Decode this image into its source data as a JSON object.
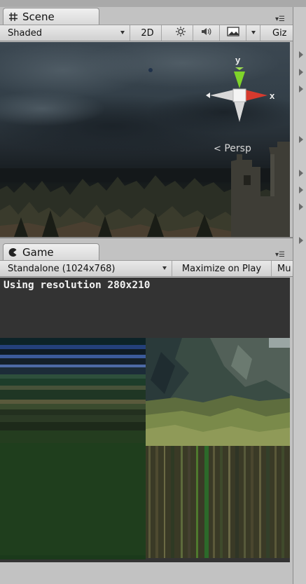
{
  "scene": {
    "tab_label": "Scene",
    "draw_mode": "Shaded",
    "mode_2d": "2D",
    "gizmos_label": "Giz",
    "projection": "Persp",
    "axis_x": "x",
    "axis_y": "y"
  },
  "game": {
    "tab_label": "Game",
    "aspect": "Standalone (1024x768)",
    "maximize": "Maximize on Play",
    "mute": "Mu",
    "resolution_text": "Using resolution 280x210"
  },
  "icons": {
    "scene_tab": "hash-grid-icon",
    "game_tab": "pacman-icon",
    "lighting": "sun-icon",
    "audio": "speaker-icon",
    "effects": "image-icon",
    "menu": "kebab-menu-icon",
    "foldout": "triangle-right-icon"
  }
}
